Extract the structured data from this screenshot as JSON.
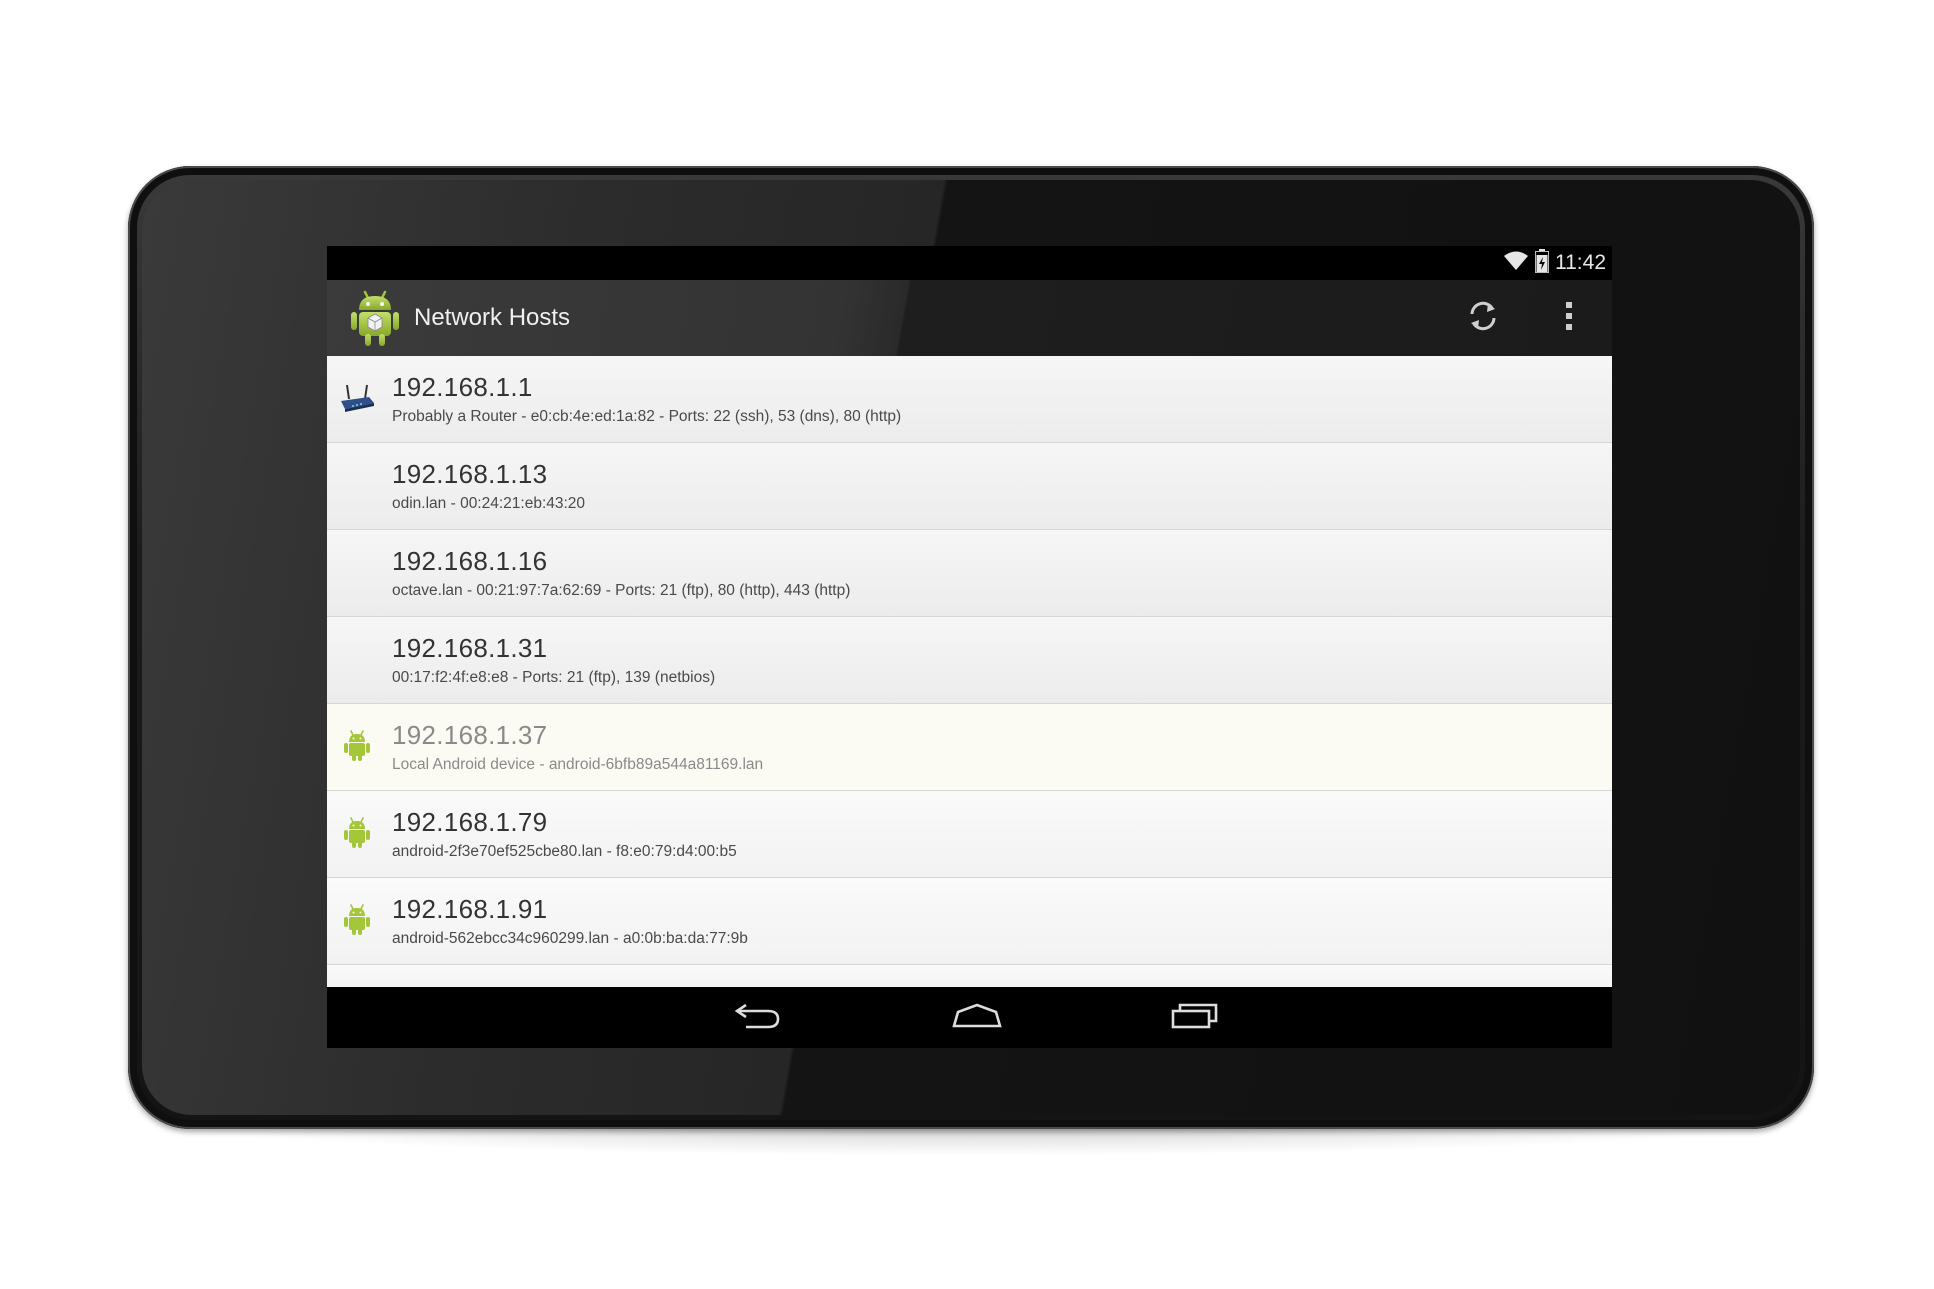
{
  "status_bar": {
    "time": "11:42",
    "icons": [
      "wifi-icon",
      "battery-icon"
    ]
  },
  "action_bar": {
    "app_icon": "android-robot-icon",
    "title": "Network Hosts",
    "actions": [
      "refresh-icon",
      "overflow-menu-icon"
    ]
  },
  "hosts": [
    {
      "ip": "192.168.1.1",
      "detail": "Probably a Router - e0:cb:4e:ed:1a:82 - Ports: 22 (ssh), 53 (dns), 80 (http)",
      "icon": "router-icon"
    },
    {
      "ip": "192.168.1.13",
      "detail": "odin.lan - 00:24:21:eb:43:20",
      "icon": ""
    },
    {
      "ip": "192.168.1.16",
      "detail": "octave.lan - 00:21:97:7a:62:69 - Ports: 21 (ftp), 80 (http), 443 (http)",
      "icon": ""
    },
    {
      "ip": "192.168.1.31",
      "detail": "00:17:f2:4f:e8:e8 - Ports: 21 (ftp), 139 (netbios)",
      "icon": ""
    },
    {
      "ip": "192.168.1.37",
      "detail": "Local Android device - android-6bfb89a544a81169.lan",
      "icon": "android-icon"
    },
    {
      "ip": "192.168.1.79",
      "detail": "android-2f3e70ef525cbe80.lan - f8:e0:79:d4:00:b5",
      "icon": "android-icon"
    },
    {
      "ip": "192.168.1.91",
      "detail": "android-562ebcc34c960299.lan - a0:0b:ba:da:77:9b",
      "icon": "android-icon"
    }
  ],
  "nav_bar": {
    "buttons": [
      "back-icon",
      "home-icon",
      "recents-icon"
    ]
  },
  "colors": {
    "android_green": "#a4c639",
    "action_bar": "#2a2a2a",
    "list_background": "#f4f4f4",
    "local_row": "#fbfbf3"
  }
}
